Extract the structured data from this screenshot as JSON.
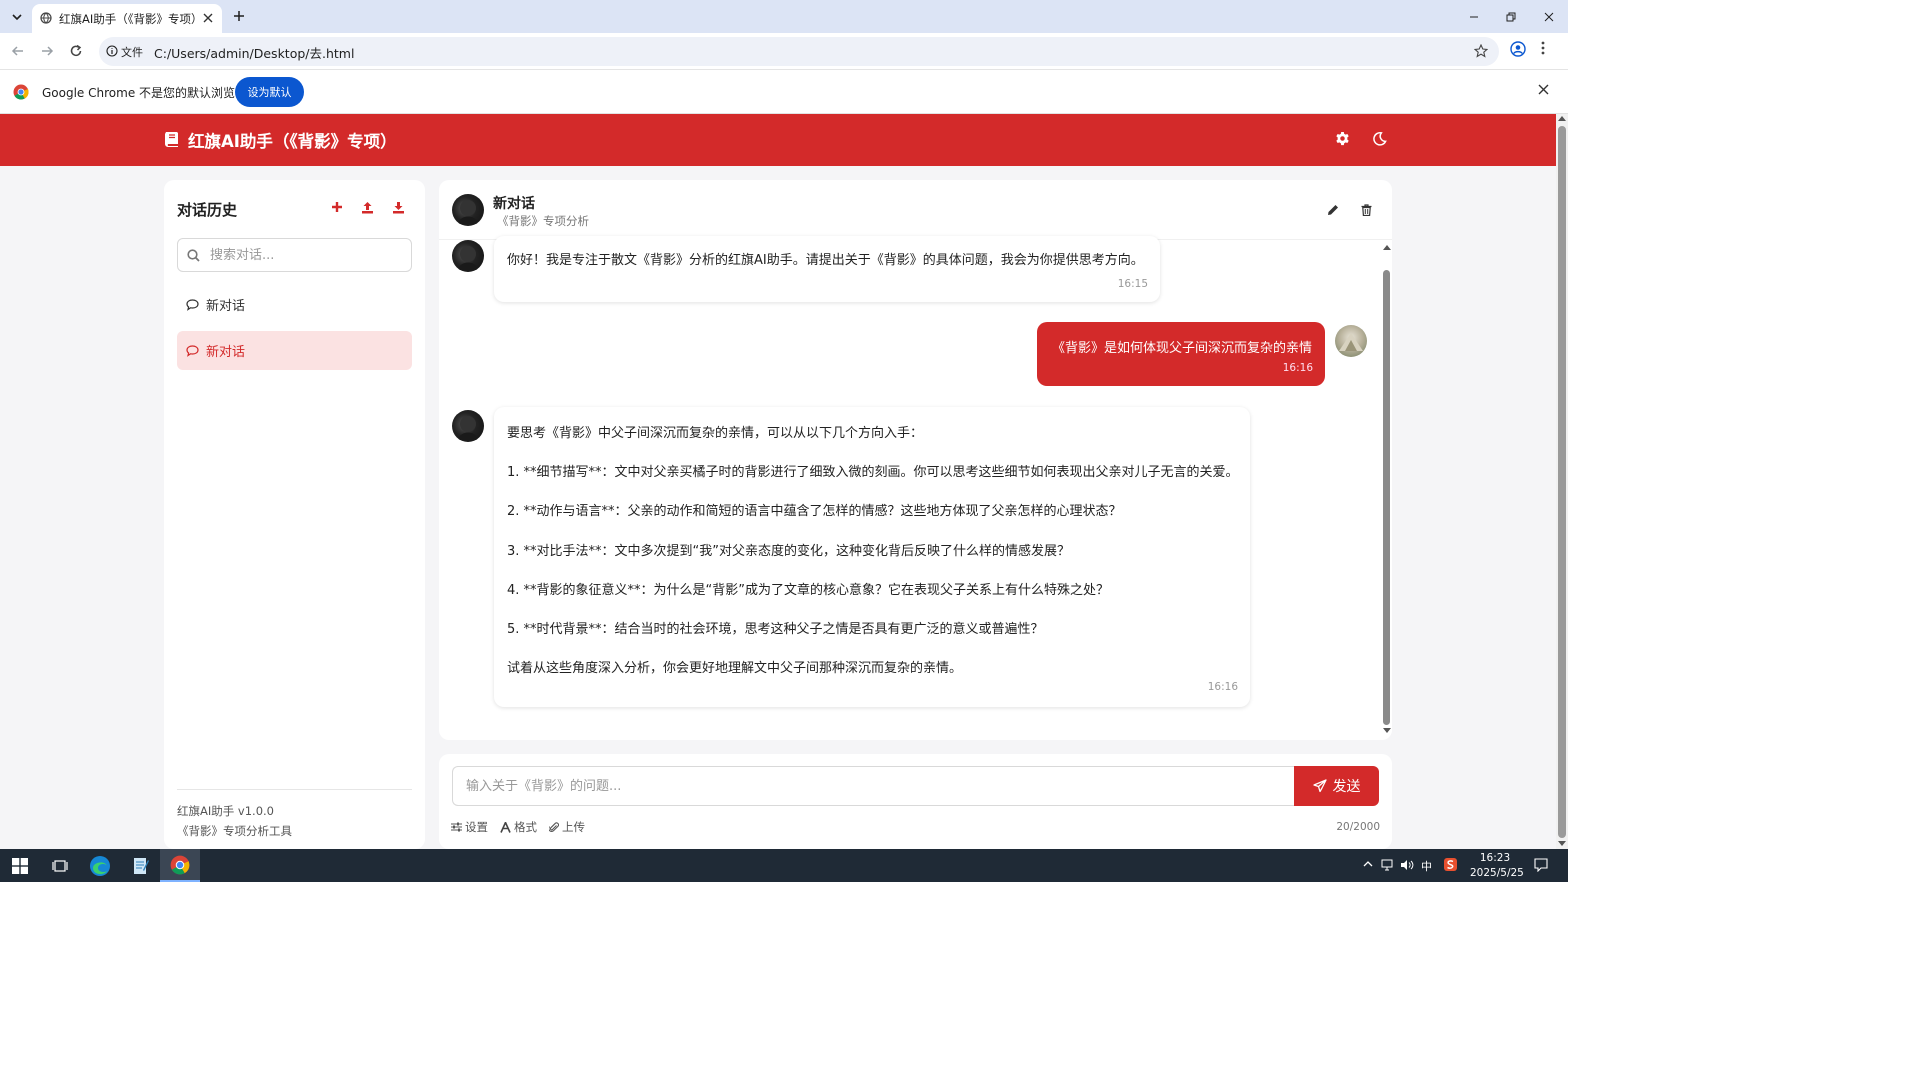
{
  "browser": {
    "tab_title": "红旗AI助手（《背影》专项）",
    "omnibox_label": "文件",
    "url": "C:/Users/admin/Desktop/去.html",
    "infobar_text": "Google Chrome 不是您的默认浏览器",
    "set_default_label": "设为默认"
  },
  "app": {
    "title": "红旗AI助手（《背影》专项）",
    "accent_color": "#d32a2a"
  },
  "sidebar": {
    "title": "对话历史",
    "search_placeholder": "搜索对话...",
    "items": [
      {
        "label": "新对话",
        "active": false
      },
      {
        "label": "新对话",
        "active": true
      }
    ],
    "footer_version": "红旗AI助手 v1.0.0",
    "footer_tagline": "《背影》专项分析工具"
  },
  "chat": {
    "title": "新对话",
    "subtitle": "《背影》专项分析",
    "messages": [
      {
        "role": "assistant",
        "lines": [
          "你好！我是专注于散文《背影》分析的红旗AI助手。请提出关于《背影》的具体问题，我会为你提供思考方向。"
        ],
        "time": "16:15"
      },
      {
        "role": "user",
        "lines": [
          "《背影》是如何体现父子间深沉而复杂的亲情"
        ],
        "time": "16:16"
      },
      {
        "role": "assistant",
        "lines": [
          "要思考《背影》中父子间深沉而复杂的亲情，可以从以下几个方向入手：",
          "1. **细节描写**：文中对父亲买橘子时的背影进行了细致入微的刻画。你可以思考这些细节如何表现出父亲对儿子无言的关爱。",
          "2. **动作与语言**：父亲的动作和简短的语言中蕴含了怎样的情感？这些地方体现了父亲怎样的心理状态？",
          "3. **对比手法**：文中多次提到“我”对父亲态度的变化，这种变化背后反映了什么样的情感发展？",
          "4. **背影的象征意义**：为什么是“背影”成为了文章的核心意象？它在表现父子关系上有什么特殊之处？",
          "5. **时代背景**：结合当时的社会环境，思考这种父子之情是否具有更广泛的意义或普遍性？",
          "试着从这些角度深入分析，你会更好地理解文中父子间那种深沉而复杂的亲情。"
        ],
        "time": "16:16"
      }
    ]
  },
  "composer": {
    "placeholder": "输入关于《背影》的问题...",
    "send_label": "发送",
    "tools": [
      "设置",
      "格式",
      "上传"
    ],
    "char_count": "20/2000"
  },
  "taskbar": {
    "ime": "中",
    "time": "16:23",
    "date": "2025/5/25"
  }
}
